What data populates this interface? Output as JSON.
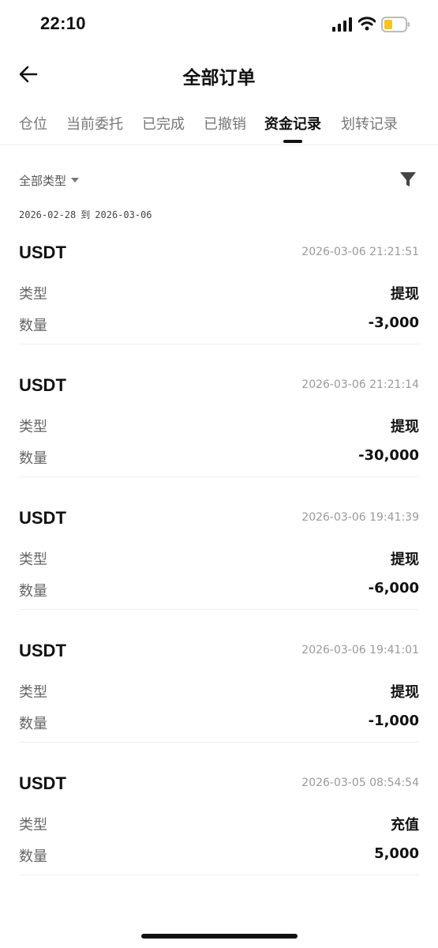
{
  "status_bar": {
    "time": "22:10"
  },
  "header": {
    "title": "全部订单"
  },
  "tabs": [
    {
      "label": "仓位"
    },
    {
      "label": "当前委托"
    },
    {
      "label": "已完成"
    },
    {
      "label": "已撤销"
    },
    {
      "label": "资金记录"
    },
    {
      "label": "划转记录"
    }
  ],
  "active_tab": "资金记录",
  "filter": {
    "type_label": "全部类型"
  },
  "date_range": {
    "from": "2026-02-28",
    "to_label": "到",
    "to": "2026-03-06"
  },
  "labels": {
    "type": "类型",
    "amount": "数量"
  },
  "records": [
    {
      "currency": "USDT",
      "time": "2026-03-06 21:21:51",
      "type": "提现",
      "amount": "-3,000"
    },
    {
      "currency": "USDT",
      "time": "2026-03-06 21:21:14",
      "type": "提现",
      "amount": "-30,000"
    },
    {
      "currency": "USDT",
      "time": "2026-03-06 19:41:39",
      "type": "提现",
      "amount": "-6,000"
    },
    {
      "currency": "USDT",
      "time": "2026-03-06 19:41:01",
      "type": "提现",
      "amount": "-1,000"
    },
    {
      "currency": "USDT",
      "time": "2026-03-05 08:54:54",
      "type": "充值",
      "amount": "5,000"
    }
  ]
}
